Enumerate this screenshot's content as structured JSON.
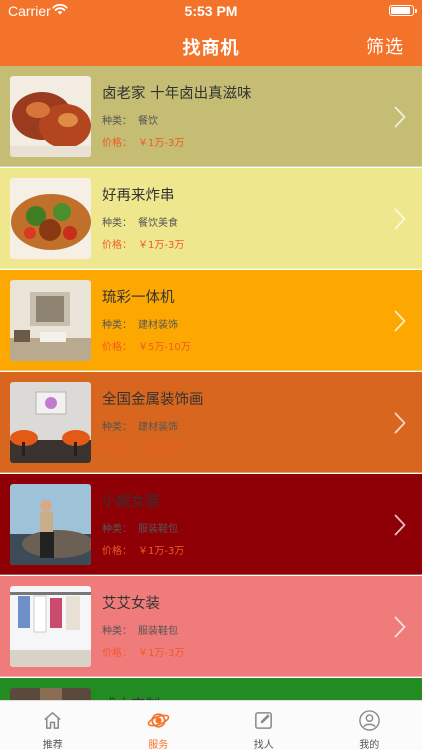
{
  "status_bar": {
    "carrier": "Carrier",
    "time": "5:53 PM",
    "battery_level": 0.95
  },
  "nav": {
    "title": "找商机",
    "filter_label": "筛选"
  },
  "category_prefix": "种类：",
  "price_prefix": "价格：",
  "items": [
    {
      "title": "卤老家 十年卤出真滋味",
      "category": "餐饮",
      "price": "￥1万-3万",
      "bg": "#c5bd74",
      "image": "braised-meat"
    },
    {
      "title": "好再来炸串",
      "category": "餐饮美食",
      "price": "￥1万-3万",
      "bg": "#efe78e",
      "image": "fried-skewers"
    },
    {
      "title": "琉彩一体机",
      "category": "建材装饰",
      "price": "￥5万-10万",
      "bg": "#fda800",
      "image": "living-room"
    },
    {
      "title": "全国金属装饰画",
      "category": "建材装饰",
      "price": "￥5万-8万",
      "bg": "#d9661e",
      "image": "wall-art-room"
    },
    {
      "title": "小妮女装",
      "category": "服装鞋包",
      "price": "￥1万-3万",
      "bg": "#8f0006",
      "image": "fashion-model"
    },
    {
      "title": "艾艾女装",
      "category": "服装鞋包",
      "price": "￥1万-3万",
      "bg": "#f07b7b",
      "image": "clothing-store"
    },
    {
      "title": "成衣定制",
      "category": "",
      "price": "",
      "bg": "#228b22",
      "image": "tailoring"
    }
  ],
  "tabs": [
    {
      "label": "推荐",
      "icon": "home-icon",
      "active": false
    },
    {
      "label": "服务",
      "icon": "planet-icon",
      "active": true
    },
    {
      "label": "找人",
      "icon": "edit-icon",
      "active": false
    },
    {
      "label": "我的",
      "icon": "person-icon",
      "active": false
    }
  ],
  "colors": {
    "brand": "#f4732a",
    "price": "#f05a24"
  }
}
